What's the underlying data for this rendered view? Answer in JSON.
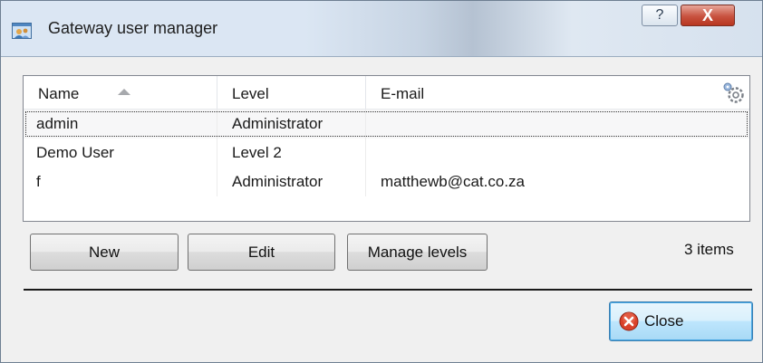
{
  "window": {
    "title": "Gateway user manager",
    "help_glyph": "?",
    "close_glyph": "X"
  },
  "list": {
    "columns": [
      "Name",
      "Level",
      "E-mail"
    ],
    "rows": [
      {
        "name": "admin",
        "level": "Administrator",
        "email": ""
      },
      {
        "name": "Demo User",
        "level": "Level 2",
        "email": ""
      },
      {
        "name": "f",
        "level": "Administrator",
        "email": "matthewb@cat.co.za"
      }
    ],
    "sorted_by": "Name",
    "sort_direction": "ascending",
    "selected_row": "admin"
  },
  "buttons": {
    "new": "New",
    "edit": "Edit",
    "manage_levels": "Manage levels",
    "close": "Close"
  },
  "status": {
    "items_count": "3 items"
  },
  "icons": {
    "app": "user-manager-icon",
    "columns_settings": "gear-icon",
    "close_button": "close-circle-icon"
  },
  "colors": {
    "close_button_accent": "#3c7fb1",
    "title_close_button": "#c8523f"
  }
}
